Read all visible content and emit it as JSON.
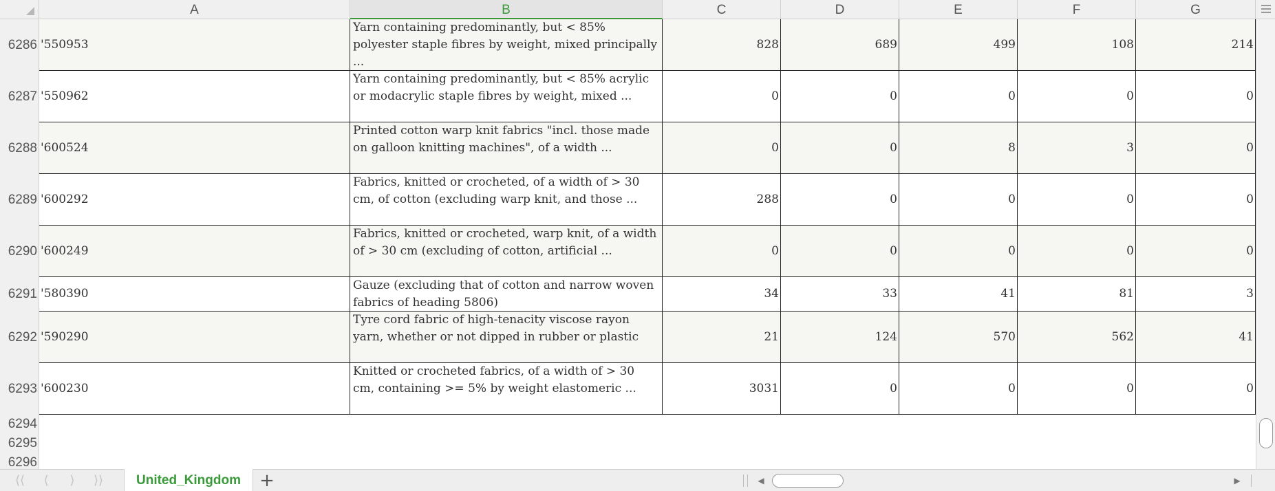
{
  "columns": [
    "A",
    "B",
    "C",
    "D",
    "E",
    "F",
    "G"
  ],
  "active_column": "B",
  "rows": [
    {
      "num": "6286",
      "code": "'550953",
      "description": "Yarn containing predominantly, but < 85% polyester staple fibres by weight, mixed principally ...",
      "values": [
        "828",
        "689",
        "499",
        "108",
        "214"
      ]
    },
    {
      "num": "6287",
      "code": "'550962",
      "description": "Yarn containing predominantly, but < 85% acrylic or modacrylic staple fibres by weight, mixed ...",
      "values": [
        "0",
        "0",
        "0",
        "0",
        "0"
      ]
    },
    {
      "num": "6288",
      "code": "'600524",
      "description": "Printed cotton warp knit fabrics \"incl. those made on galloon knitting machines\", of a width ...",
      "values": [
        "0",
        "0",
        "8",
        "3",
        "0"
      ]
    },
    {
      "num": "6289",
      "code": "'600292",
      "description": "Fabrics, knitted or crocheted, of a width of > 30 cm, of cotton (excluding warp knit, and those ...",
      "values": [
        "288",
        "0",
        "0",
        "0",
        "0"
      ]
    },
    {
      "num": "6290",
      "code": "'600249",
      "description": "Fabrics, knitted or crocheted, warp knit, of a width of > 30 cm (excluding of cotton, artificial ...",
      "values": [
        "0",
        "0",
        "0",
        "0",
        "0"
      ]
    },
    {
      "num": "6291",
      "code": "'580390",
      "description": "Gauze (excluding that of cotton and narrow woven fabrics of heading 5806)",
      "values": [
        "34",
        "33",
        "41",
        "81",
        "3"
      ]
    },
    {
      "num": "6292",
      "code": "'590290",
      "description": "Tyre cord fabric of high-tenacity viscose rayon yarn, whether or not dipped in rubber or plastic",
      "values": [
        "21",
        "124",
        "570",
        "562",
        "41"
      ]
    },
    {
      "num": "6293",
      "code": "'600230",
      "description": "Knitted or crocheted fabrics, of a width of > 30 cm, containing >= 5% by weight elastomeric ...",
      "values": [
        "3031",
        "0",
        "0",
        "0",
        "0"
      ]
    }
  ],
  "empty_rows": [
    "6294",
    "6295",
    "6296"
  ],
  "sheet_tab": "United_Kingdom",
  "add_sheet_label": "+",
  "nav": {
    "first": "⟨⟨",
    "prev": "⟨",
    "next": "⟩",
    "last": "⟩⟩"
  },
  "accent_color": "#3a9a3a"
}
